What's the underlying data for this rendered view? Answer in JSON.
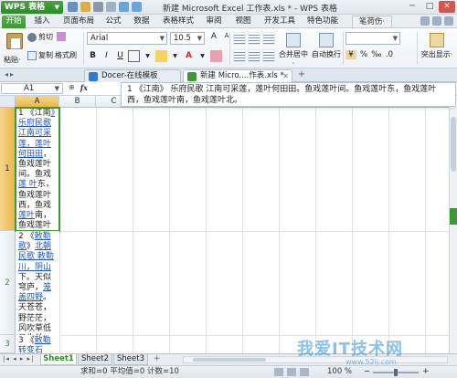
{
  "app": {
    "menu_button": "WPS 表格",
    "window_title": "新建 Microsoft Excel 工作表.xls * - WPS 表格",
    "minimize": "─",
    "maximize": "□",
    "close": "✕"
  },
  "menu_tabs": [
    {
      "label": "开始"
    },
    {
      "label": "插入"
    },
    {
      "label": "页面布局"
    },
    {
      "label": "公式"
    },
    {
      "label": "数据"
    },
    {
      "label": "表格样式"
    },
    {
      "label": "审阅"
    },
    {
      "label": "视图"
    },
    {
      "label": "开发工具"
    },
    {
      "label": "特色功能"
    },
    {
      "label": "笔荷伤·"
    }
  ],
  "ribbon": {
    "paste": "粘贴·",
    "cut": "剪切",
    "copy": "复制",
    "format_painter": "格式刷",
    "font_name": "Arial",
    "font_size": "10.5",
    "bold": "B",
    "italic": "I",
    "underline": "U",
    "merge_center": "合并居中·",
    "wrap_text": "自动换行",
    "number_format_placeholder": "",
    "percent": "%",
    "comma": "‰",
    "highlight": "突出显示·"
  },
  "doc_tabs": [
    {
      "label": "Docer-在线模板",
      "icon_color": "#2f7ad1"
    },
    {
      "label": "新建 Micro....作表.xls *",
      "icon_color": "#3a9a33"
    }
  ],
  "formula_bar": {
    "cell_ref": "A1",
    "fx": "fx",
    "content": "1 《江南》 乐府民歌 江南可采莲，莲叶何田田。鱼戏莲叶间。鱼戏莲叶东，鱼戏莲叶西，鱼戏莲叶南，鱼戏莲叶北。"
  },
  "grid": {
    "columns": [
      "A",
      "B",
      "C",
      "D",
      "E",
      "F",
      "G",
      "H",
      "I",
      "J",
      "K"
    ],
    "rows": [
      "1",
      "2",
      "3"
    ],
    "cell_a1_parts": [
      {
        "text": "1 《江南",
        "link": false
      },
      {
        "text": "》乐府民歌 江南可采莲，莲叶何田田",
        "link": true
      },
      {
        "text": "，鱼戏莲叶间。鱼戏",
        "link": false
      },
      {
        "text": "莲 叶",
        "link": true
      },
      {
        "text": "东，鱼戏莲叶西，鱼戏",
        "link": false
      },
      {
        "text": "莲叶",
        "link": true
      },
      {
        "text": "南，鱼戏莲叶北。",
        "link": false
      }
    ],
    "cell_a2_parts": [
      {
        "text": "2 《",
        "link": false
      },
      {
        "text": "敕勒歌",
        "link": true
      },
      {
        "text": "》",
        "link": false
      },
      {
        "text": "北朝民歌 敕勒川，阴山",
        "link": true
      },
      {
        "text": "下。天似穹庐，",
        "link": false
      },
      {
        "text": "笼盖四野",
        "link": true
      },
      {
        "text": "。天苍苍，野茫茫，风吹草低见牛羊。",
        "link": false
      }
    ],
    "cell_a3_parts": [
      {
        "text": "3 《",
        "link": false
      },
      {
        "text": "敕勒",
        "link": true
      },
      {
        "text": " ",
        "link": false
      },
      {
        "text": "转变石",
        "link": true
      }
    ]
  },
  "sheets": [
    {
      "label": "Sheet1",
      "active": true
    },
    {
      "label": "Sheet2",
      "active": false
    },
    {
      "label": "Sheet3",
      "active": false
    }
  ],
  "status": {
    "summary": "求和=0  平均值=0  计数=10",
    "zoom": "100 %",
    "zoom_out": "−",
    "zoom_in": "+",
    "zoom_level": 0.5
  },
  "watermark": {
    "text": "我爱IT技术网",
    "url": "www.52ij.com"
  },
  "colors": {
    "accent_green": "#3a9a33",
    "link_blue": "#1f56b3",
    "selection_orange": "#e8b84a"
  }
}
